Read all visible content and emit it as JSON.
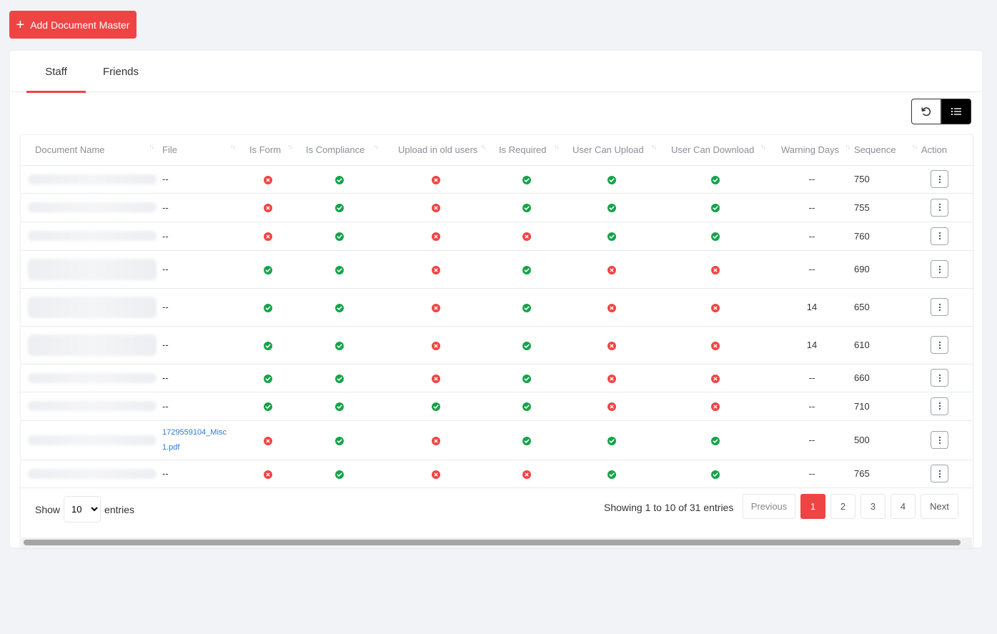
{
  "add_button": {
    "label": "Add Document Master"
  },
  "tabs": [
    {
      "label": "Staff"
    },
    {
      "label": "Friends"
    }
  ],
  "toolbar": {
    "refresh_icon": "refresh-icon",
    "list_icon": "list-icon"
  },
  "table": {
    "columns": [
      "Document Name",
      "File",
      "Is Form",
      "Is Compliance",
      "Upload in old users",
      "Is Required",
      "User Can Upload",
      "User Can Download",
      "Warning Days",
      "Sequence",
      "Action"
    ],
    "rows": [
      {
        "file": "--",
        "is_form": false,
        "is_compliance": true,
        "upload_old": false,
        "is_required": true,
        "can_upload": true,
        "can_download": true,
        "warning_days": "--",
        "sequence": "750"
      },
      {
        "file": "--",
        "is_form": false,
        "is_compliance": true,
        "upload_old": false,
        "is_required": true,
        "can_upload": true,
        "can_download": true,
        "warning_days": "--",
        "sequence": "755"
      },
      {
        "file": "--",
        "is_form": false,
        "is_compliance": true,
        "upload_old": false,
        "is_required": false,
        "can_upload": true,
        "can_download": true,
        "warning_days": "--",
        "sequence": "760"
      },
      {
        "file": "--",
        "is_form": true,
        "is_compliance": true,
        "upload_old": false,
        "is_required": true,
        "can_upload": false,
        "can_download": false,
        "warning_days": "--",
        "sequence": "690"
      },
      {
        "file": "--",
        "is_form": true,
        "is_compliance": true,
        "upload_old": false,
        "is_required": true,
        "can_upload": false,
        "can_download": false,
        "warning_days": "14",
        "sequence": "650"
      },
      {
        "file": "--",
        "is_form": true,
        "is_compliance": true,
        "upload_old": false,
        "is_required": true,
        "can_upload": false,
        "can_download": false,
        "warning_days": "14",
        "sequence": "610"
      },
      {
        "file": "--",
        "is_form": true,
        "is_compliance": true,
        "upload_old": false,
        "is_required": true,
        "can_upload": false,
        "can_download": false,
        "warning_days": "--",
        "sequence": "660"
      },
      {
        "file": "--",
        "is_form": true,
        "is_compliance": true,
        "upload_old": true,
        "is_required": true,
        "can_upload": false,
        "can_download": false,
        "warning_days": "--",
        "sequence": "710"
      },
      {
        "file_link_1": "1729559104_Misc",
        "file_link_2": "1.pdf",
        "is_form": false,
        "is_compliance": true,
        "upload_old": false,
        "is_required": true,
        "can_upload": true,
        "can_download": true,
        "warning_days": "--",
        "sequence": "500"
      },
      {
        "file": "--",
        "is_form": false,
        "is_compliance": true,
        "upload_old": false,
        "is_required": false,
        "can_upload": true,
        "can_download": true,
        "warning_days": "--",
        "sequence": "765"
      }
    ]
  },
  "footer": {
    "show_label": "Show",
    "page_size": "10",
    "entries_label": "entries",
    "info": "Showing 1 to 10 of 31 entries",
    "prev_label": "Previous",
    "pages": [
      "1",
      "2",
      "3",
      "4"
    ],
    "current_page": "1",
    "next_label": "Next"
  },
  "colors": {
    "accent": "#ef4444",
    "ok": "#16a34a",
    "no": "#ef4444"
  }
}
